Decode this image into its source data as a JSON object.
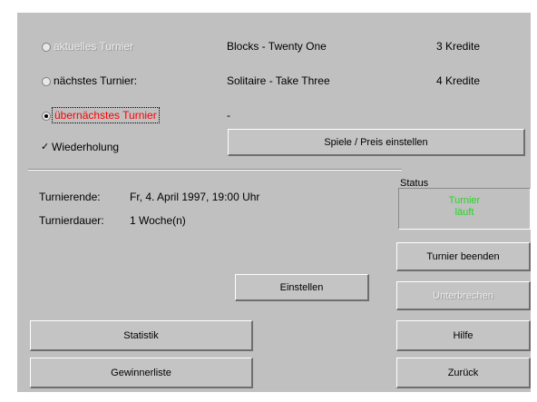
{
  "turnier": {
    "aktuelles": {
      "label": "aktuelles Turnier",
      "game": "Blocks - Twenty One",
      "credits": "3 Kredite"
    },
    "naechstes": {
      "label": "nächstes Turnier:",
      "game": "Solitaire - Take Three",
      "credits": "4 Kredite"
    },
    "uebernaechstes": {
      "label": "übernächstes Turnier",
      "game": "-"
    },
    "wiederholung": {
      "label": "Wiederholung",
      "check_mark": "✓"
    }
  },
  "buttons": {
    "spiele_preis": "Spiele / Preis einstellen",
    "einstellen": "Einstellen",
    "turnier_beenden": "Turnier beenden",
    "unterbrechen": "Unterbrechen",
    "statistik": "Statistik",
    "hilfe": "Hilfe",
    "gewinnerliste": "Gewinnerliste",
    "zurueck": "Zurück"
  },
  "info": {
    "turnierende_label": "Turnierende:",
    "turnierende_value": "Fr, 4. April 1997, 19:00 Uhr",
    "turnierdauer_label": "Turnierdauer:",
    "turnierdauer_value": "1 Woche(n)"
  },
  "status": {
    "title": "Status",
    "line1": "Turnier",
    "line2": "läuft",
    "color": "#22d822"
  },
  "colors": {
    "panel": "#c0c0c0",
    "highlight": "#ff0000"
  }
}
